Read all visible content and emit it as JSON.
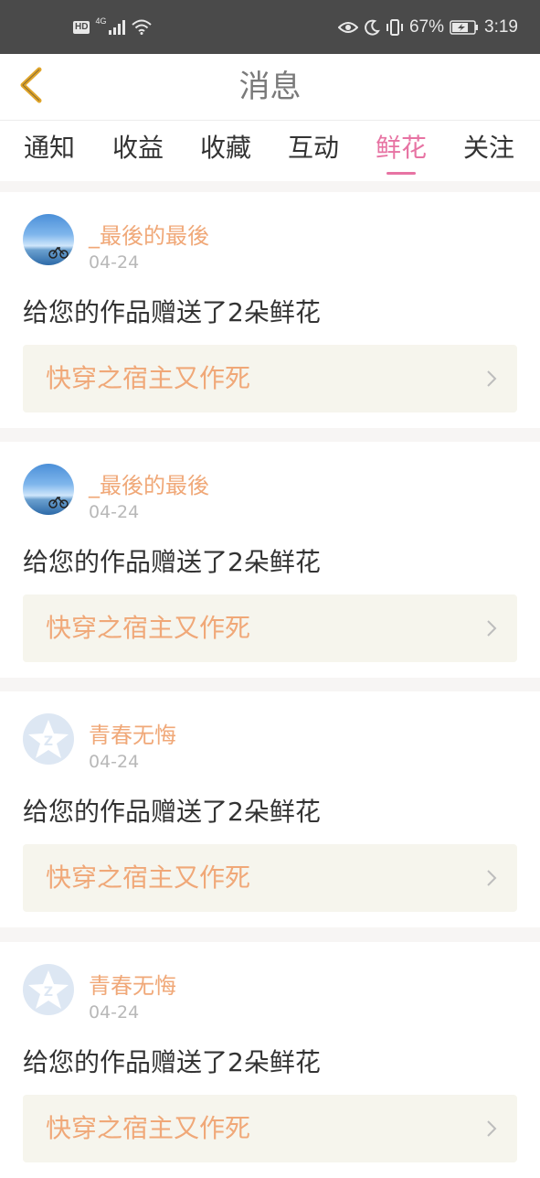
{
  "status_bar": {
    "hd": "HD",
    "network": "4G",
    "battery": "67%",
    "time": "3:19"
  },
  "header": {
    "title": "消息"
  },
  "tabs": [
    {
      "label": "通知",
      "active": false
    },
    {
      "label": "收益",
      "active": false
    },
    {
      "label": "收藏",
      "active": false
    },
    {
      "label": "互动",
      "active": false
    },
    {
      "label": "鲜花",
      "active": true
    },
    {
      "label": "关注",
      "active": false
    }
  ],
  "messages": [
    {
      "username": "_最後的最後",
      "date": "04-24",
      "text": "给您的作品赠送了2朵鲜花",
      "work_title": "快穿之宿主又作死",
      "avatar": "photo-avatar"
    },
    {
      "username": "_最後的最後",
      "date": "04-24",
      "text": "给您的作品赠送了2朵鲜花",
      "work_title": "快穿之宿主又作死",
      "avatar": "photo-avatar"
    },
    {
      "username": "青春无悔",
      "date": "04-24",
      "text": "给您的作品赠送了2朵鲜花",
      "work_title": "快穿之宿主又作死",
      "avatar": "qq-default-avatar"
    },
    {
      "username": "青春无悔",
      "date": "04-24",
      "text": "给您的作品赠送了2朵鲜花",
      "work_title": "快穿之宿主又作死",
      "avatar": "qq-default-avatar"
    }
  ],
  "colors": {
    "accent_pink": "#e773a3",
    "username_orange": "#f0a878",
    "link_bg": "#f6f5ed",
    "back_arrow": "#e0a52a"
  }
}
